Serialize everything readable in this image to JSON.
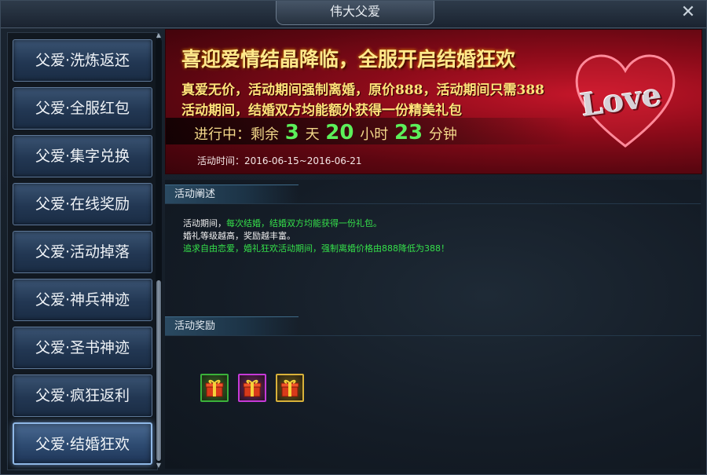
{
  "window": {
    "title": "伟大父爱",
    "close_icon": "close-icon"
  },
  "sidebar": {
    "items": [
      {
        "label": "父爱·洗炼返还",
        "active": false
      },
      {
        "label": "父爱·全服红包",
        "active": false
      },
      {
        "label": "父爱·集字兑换",
        "active": false
      },
      {
        "label": "父爱·在线奖励",
        "active": false
      },
      {
        "label": "父爱·活动掉落",
        "active": false
      },
      {
        "label": "父爱·神兵神迹",
        "active": false
      },
      {
        "label": "父爱·圣书神迹",
        "active": false
      },
      {
        "label": "父爱·疯狂返利",
        "active": false
      },
      {
        "label": "父爱·结婚狂欢",
        "active": true
      }
    ]
  },
  "banner": {
    "headline": "喜迎爱情结晶降临，全服开启结婚狂欢",
    "line1": "真爱无价，活动期间强制离婚，原价888，活动期间只需388",
    "line2": "活动期间，结婚双方均能额外获得一份精美礼包",
    "countdown": {
      "prefix": "进行中：剩余",
      "days": "3",
      "days_unit": "天",
      "hours": "20",
      "hours_unit": "小时",
      "minutes": "23",
      "minutes_unit": "分钟"
    },
    "time_range": "活动时间：2016-06-15~2016-06-21",
    "logo_text": "Love",
    "colors": {
      "headline": "#ffe98c",
      "countdown_number": "#5cf05a"
    }
  },
  "description": {
    "header": "活动阐述",
    "line1_white": "活动期间，",
    "line1_green": "每次结婚，结婚双方均能获得一份礼包。",
    "line2": "婚礼等级越高，奖励越丰富。",
    "line3": "追求自由恋爱，婚礼狂欢活动期间，强制离婚价格由888降低为388！"
  },
  "rewards": {
    "header": "活动奖励",
    "items": [
      {
        "icon": "gift-box-icon",
        "rarity_color": "#3ab23a"
      },
      {
        "icon": "gift-box-icon",
        "rarity_color": "#c63ad8"
      },
      {
        "icon": "gift-box-icon",
        "rarity_color": "#d8b23a"
      }
    ]
  }
}
